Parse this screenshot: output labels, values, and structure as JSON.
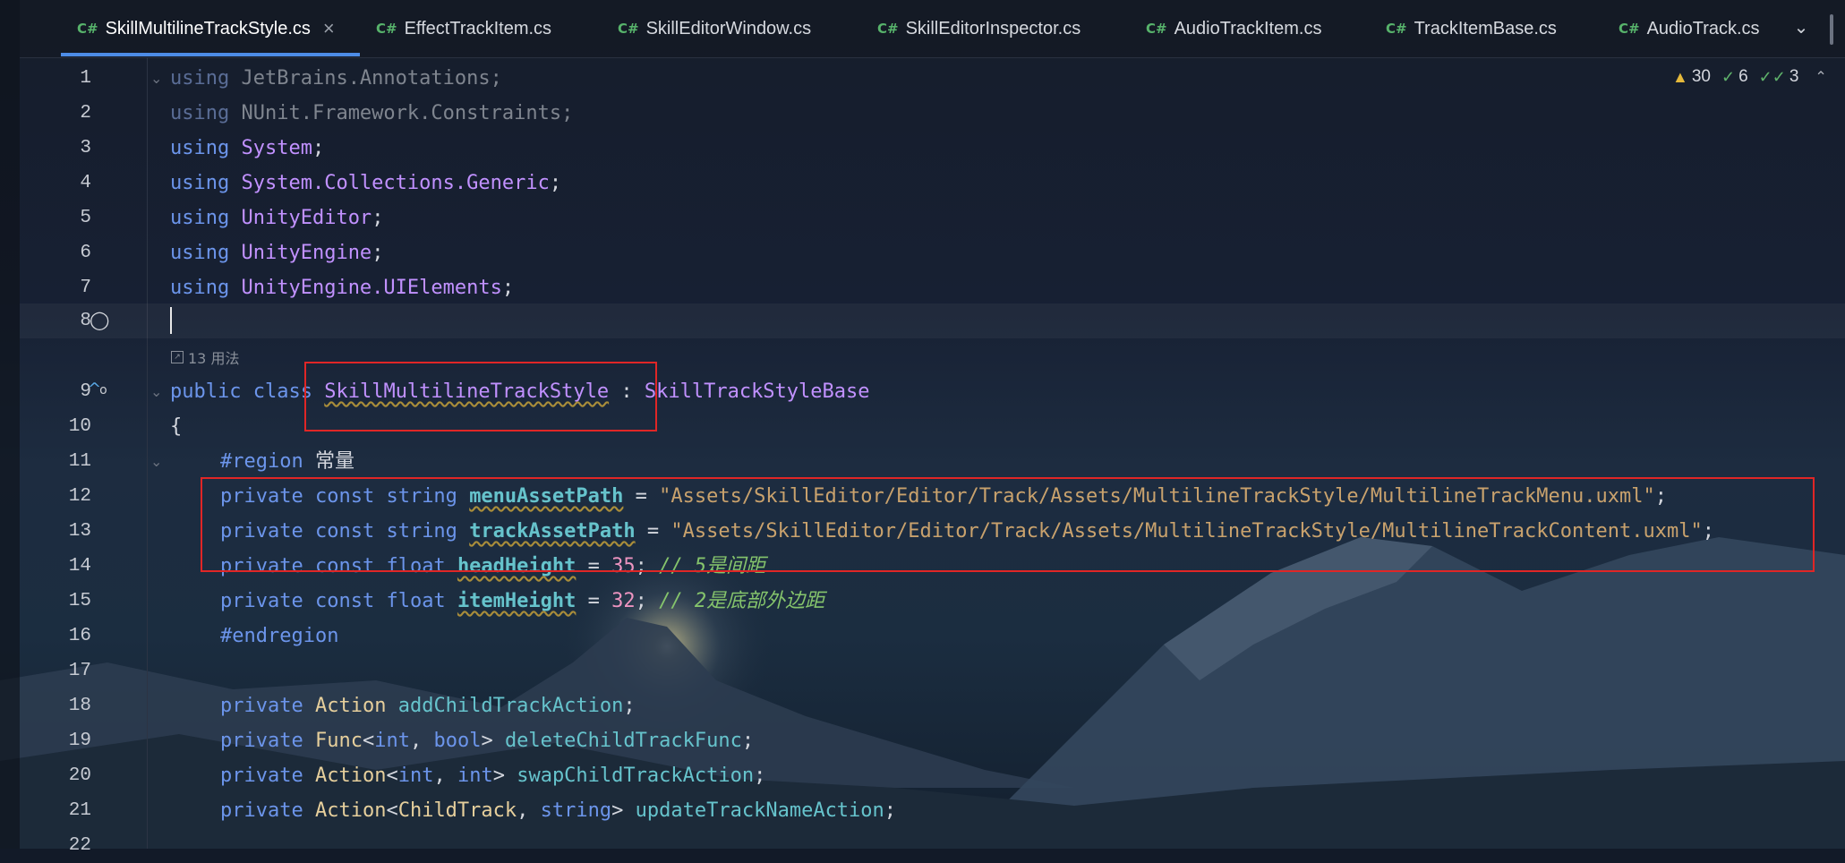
{
  "tabs": [
    {
      "lang": "C#",
      "label": "SkillMultilineTrackStyle.cs",
      "active": true,
      "close": "×"
    },
    {
      "lang": "C#",
      "label": "EffectTrackItem.cs"
    },
    {
      "lang": "C#",
      "label": "SkillEditorWindow.cs"
    },
    {
      "lang": "C#",
      "label": "SkillEditorInspector.cs"
    },
    {
      "lang": "C#",
      "label": "AudioTrackItem.cs"
    },
    {
      "lang": "C#",
      "label": "TrackItemBase.cs"
    },
    {
      "lang": "C#",
      "label": "AudioTrack.cs"
    }
  ],
  "inspections": {
    "warnings": "30",
    "weak": "6",
    "typos": "3"
  },
  "usages_hint": "13 用法",
  "lines": {
    "n1": "1",
    "n2": "2",
    "n3": "3",
    "n4": "4",
    "n5": "5",
    "n6": "6",
    "n7": "7",
    "n8": "8",
    "n9": "9",
    "n10": "10",
    "n11": "11",
    "n12": "12",
    "n13": "13",
    "n14": "14",
    "n15": "15",
    "n16": "16",
    "n17": "17",
    "n18": "18",
    "n19": "19",
    "n20": "20",
    "n21": "21",
    "n22": "22"
  },
  "code": {
    "using": "using",
    "l1_ns": "JetBrains.Annotations",
    "l2_ns": "NUnit.Framework.Constraints",
    "l3_ns": "System",
    "l4_ns1": "System.Collections.",
    "l4_ns2": "Generic",
    "l5_ns": "UnityEditor",
    "l6_ns": "UnityEngine",
    "l7_ns": "UnityEngine.UIElements",
    "semi": ";",
    "public": "public",
    "class": "class",
    "class_name": "SkillMultilineTrackStyle",
    "colon": " : ",
    "base_class": "SkillTrackStyleBase",
    "open_brace": "{",
    "region": "#region",
    "region_label": "常量",
    "private": "private",
    "const": "const",
    "string": "string",
    "float": "float",
    "menuAssetPath": "menuAssetPath",
    "trackAssetPath": "trackAssetPath",
    "headHeight": "headHeight",
    "itemHeight": "itemHeight",
    "eq": " = ",
    "menu_path": "\"Assets/SkillEditor/Editor/Track/Assets/MultilineTrackStyle/MultilineTrackMenu.uxml\"",
    "track_path": "\"Assets/SkillEditor/Editor/Track/Assets/MultilineTrackStyle/MultilineTrackContent.uxml\"",
    "head_val": "35",
    "item_val": "32",
    "head_cmt": "// 5是间距",
    "item_cmt": "// 2是底部外边距",
    "endregion": "#endregion",
    "Action": "Action",
    "Func": "Func",
    "int": "int",
    "bool": "bool",
    "ChildTrack": "ChildTrack",
    "addChildTrackAction": "addChildTrackAction",
    "deleteChildTrackFunc": "deleteChildTrackFunc",
    "swapChildTrackAction": "swapChildTrackAction",
    "updateTrackNameAction": "updateTrackNameAction"
  }
}
